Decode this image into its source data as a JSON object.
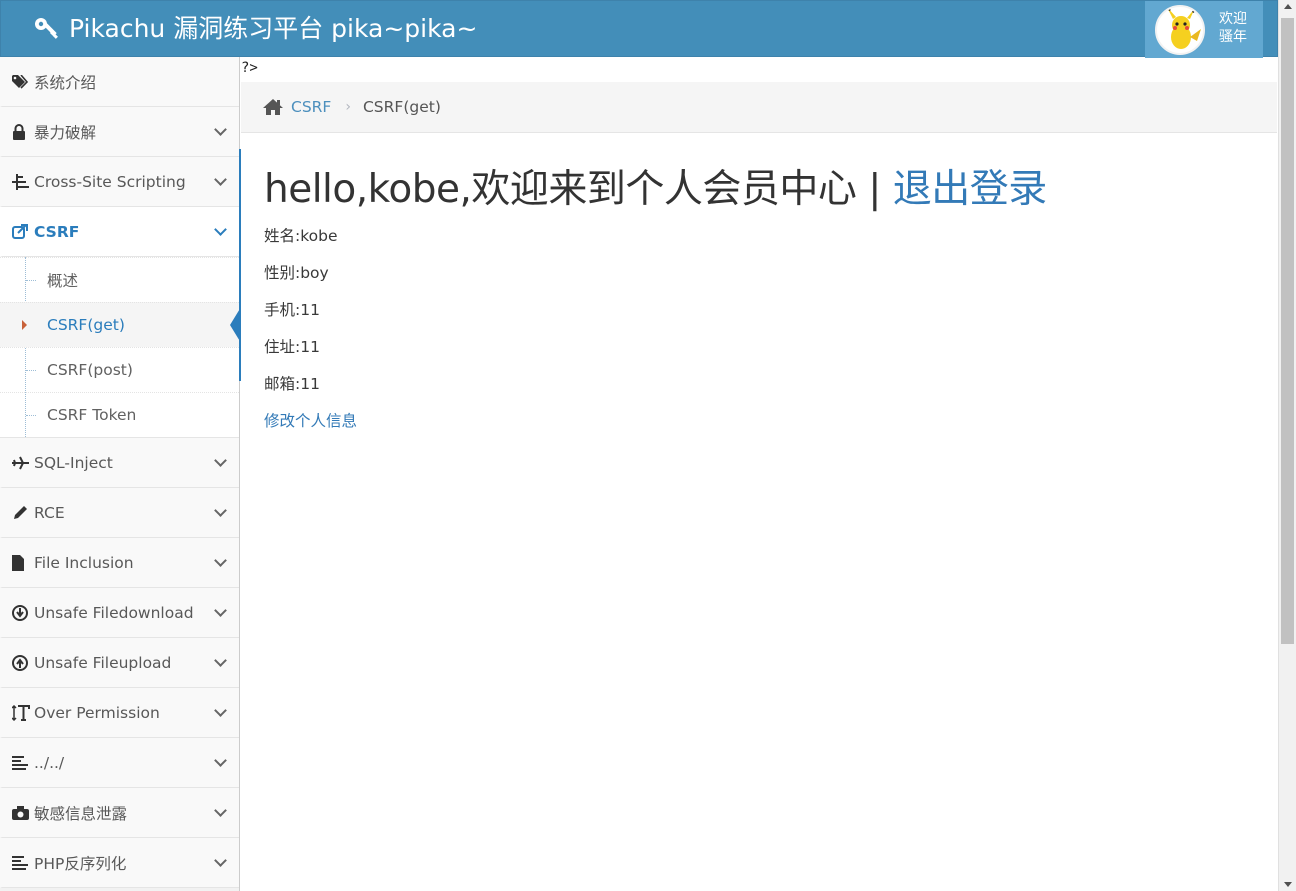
{
  "navbar": {
    "title": "Pikachu 漏洞练习平台 pika~pika~",
    "user_greeting_line1": "欢迎",
    "user_greeting_line2": "骚年",
    "brand_color": "#438eb9"
  },
  "sidebar": {
    "items": [
      {
        "label": "系统介绍",
        "icon": "tags-icon"
      },
      {
        "label": "暴力破解",
        "icon": "lock-icon"
      },
      {
        "label": "Cross-Site Scripting",
        "icon": "sitemap-icon"
      },
      {
        "label": "CSRF",
        "icon": "share-icon",
        "active": true
      },
      {
        "label": "SQL-Inject",
        "icon": "plane-icon"
      },
      {
        "label": "RCE",
        "icon": "pencil-icon"
      },
      {
        "label": "File Inclusion",
        "icon": "file-icon"
      },
      {
        "label": "Unsafe Filedownload",
        "icon": "download-circle-icon"
      },
      {
        "label": "Unsafe Fileupload",
        "icon": "upload-circle-icon"
      },
      {
        "label": "Over Permission",
        "icon": "text-height-icon"
      },
      {
        "label": "../../",
        "icon": "align-left-icon"
      },
      {
        "label": "敏感信息泄露",
        "icon": "camera-icon"
      },
      {
        "label": "PHP反序列化",
        "icon": "align-left-icon"
      }
    ],
    "csrf_submenu": [
      {
        "label": "概述"
      },
      {
        "label": "CSRF(get)",
        "active": true
      },
      {
        "label": "CSRF(post)"
      },
      {
        "label": "CSRF Token"
      }
    ]
  },
  "stray_text": "?>",
  "breadcrumb": {
    "parent": "CSRF",
    "current": "CSRF(get)"
  },
  "main": {
    "heading_text": "hello,kobe,欢迎来到个人会员中心 | ",
    "logout_link": "退出登录",
    "fields": {
      "name": "姓名:kobe",
      "gender": "性别:boy",
      "phone": "手机:11",
      "address": "住址:11",
      "email": "邮箱:11"
    },
    "edit_link": "修改个人信息"
  }
}
